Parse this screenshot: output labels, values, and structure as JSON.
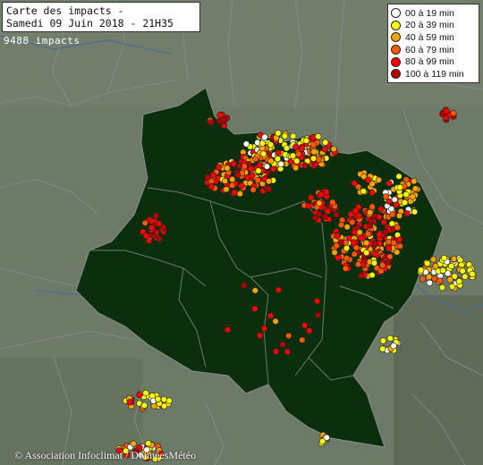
{
  "title": {
    "line1": "Carte des impacts -",
    "line2": "Samedi 09 Juin 2018 - 21H35"
  },
  "impacts_count": "9488 impacts",
  "legend": [
    {
      "label": "00 à 19 min",
      "color": "#ffffff"
    },
    {
      "label": "20 à 39 min",
      "color": "#ffff00"
    },
    {
      "label": "40 à 59 min",
      "color": "#ffa500"
    },
    {
      "label": "60 à 79 min",
      "color": "#ff5a00"
    },
    {
      "label": "80 à 99 min",
      "color": "#ff0000"
    },
    {
      "label": "100 à 119 min",
      "color": "#b40000"
    }
  ],
  "credit": "© Association Infoclimat / DonnéesMétéo",
  "colors": {
    "land": "#6d7a68",
    "region": "#0b2f0d",
    "border": "#8a8f8a",
    "river": "#4f6f88"
  }
}
